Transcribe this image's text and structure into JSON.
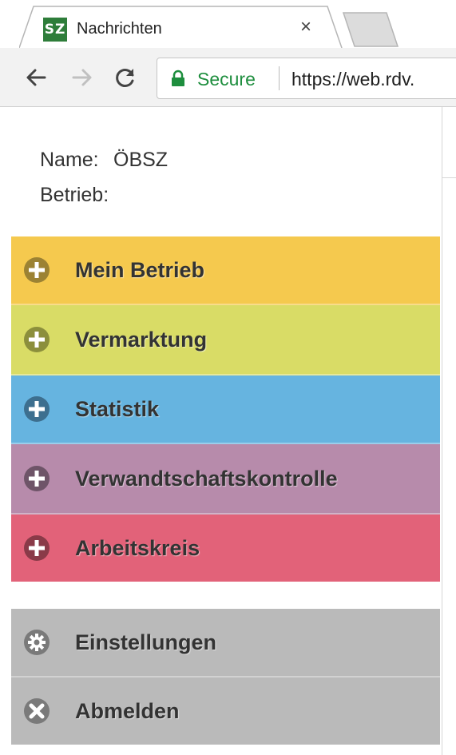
{
  "browser": {
    "tab_title": "Nachrichten",
    "favicon_text": "SZ",
    "close_glyph": "×",
    "secure_label": "Secure",
    "url": "https://web.rdv.",
    "icons": [
      "back-arrow-icon",
      "forward-arrow-icon",
      "reload-icon",
      "lock-icon"
    ]
  },
  "user": {
    "name_label": "Name:",
    "name_value": "ÖBSZ",
    "betrieb_label": "Betrieb:",
    "betrieb_value": ""
  },
  "menu": [
    {
      "label": "Mein Betrieb",
      "color": "#f5c94e",
      "icon_color": "#9c8233",
      "icon": "plus-circle-icon"
    },
    {
      "label": "Vermarktung",
      "color": "#d9dc66",
      "icon_color": "#8c8f3c",
      "icon": "plus-circle-icon"
    },
    {
      "label": "Statistik",
      "color": "#66b4e0",
      "icon_color": "#3d6f8f",
      "icon": "plus-circle-icon"
    },
    {
      "label": "Verwandtschaftskontrolle",
      "color": "#b78bab",
      "icon_color": "#6e5468",
      "icon": "plus-circle-icon"
    },
    {
      "label": "Arbeitskreis",
      "color": "#e26279",
      "icon_color": "#8a3a48",
      "icon": "plus-circle-icon"
    }
  ],
  "bottom_menu": [
    {
      "label": "Einstellungen",
      "color": "#bababa",
      "icon_color": "#7a7a7a",
      "icon": "gear-icon"
    },
    {
      "label": "Abmelden",
      "color": "#bababa",
      "icon_color": "#7a7a7a",
      "icon": "close-circle-icon"
    }
  ]
}
